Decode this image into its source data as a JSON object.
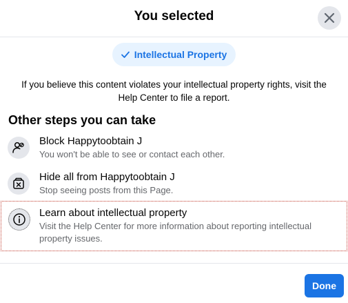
{
  "dialog": {
    "title": "You selected",
    "close_icon": "close-icon"
  },
  "selected_chip": {
    "label": "Intellectual Property",
    "icon": "checkmark-icon",
    "color": "#1b74e4",
    "background": "#e7f3ff"
  },
  "info_text": "If you believe this content violates your intellectual property rights, visit the Help Center to file a report.",
  "section_title": "Other steps you can take",
  "options": [
    {
      "icon": "block-user-icon",
      "title": "Block Happytoobtain J",
      "description": "You won't be able to see or contact each other."
    },
    {
      "icon": "hide-icon",
      "title": "Hide all from Happytoobtain J",
      "description": "Stop seeing posts from this Page."
    },
    {
      "icon": "info-icon",
      "title": "Learn about intellectual property",
      "description": "Visit the Help Center for more information about reporting intellectual property issues."
    }
  ],
  "footer": {
    "done_label": "Done",
    "accent_color": "#1b74e4"
  }
}
